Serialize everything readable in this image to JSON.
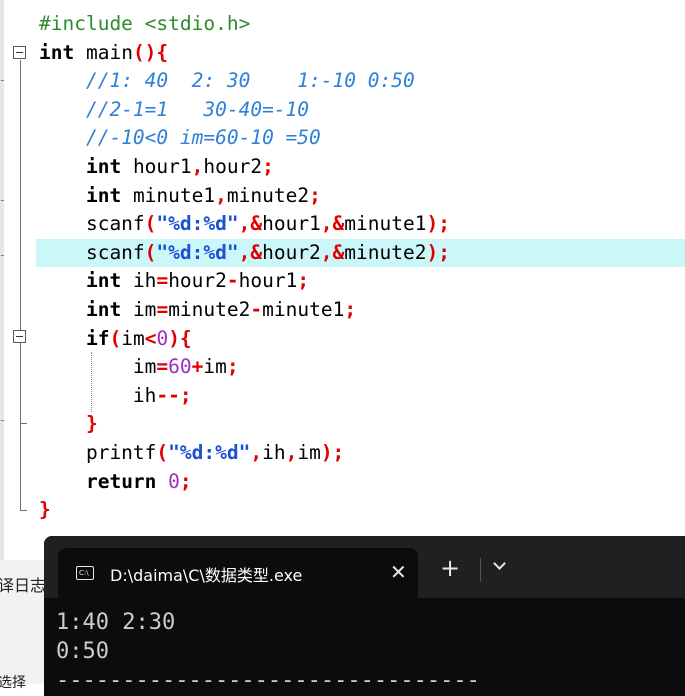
{
  "editor": {
    "lines": [
      [
        {
          "c": "pp",
          "t": "#include <stdio.h>"
        }
      ],
      [
        {
          "c": "k",
          "t": "int"
        },
        {
          "c": "x",
          "t": " main"
        },
        {
          "c": "p",
          "t": "(){"
        }
      ],
      [
        {
          "c": "x",
          "t": "    "
        },
        {
          "c": "cm",
          "t": "//1: 40  2: 30    1:-10 0:50"
        }
      ],
      [
        {
          "c": "x",
          "t": "    "
        },
        {
          "c": "cm",
          "t": "//2-1=1   30-40=-10"
        }
      ],
      [
        {
          "c": "x",
          "t": "    "
        },
        {
          "c": "cm",
          "t": "//-10<0 im=60-10 =50"
        }
      ],
      [
        {
          "c": "x",
          "t": "    "
        },
        {
          "c": "k",
          "t": "int"
        },
        {
          "c": "x",
          "t": " hour1"
        },
        {
          "c": "p",
          "t": ","
        },
        {
          "c": "x",
          "t": "hour2"
        },
        {
          "c": "p",
          "t": ";"
        }
      ],
      [
        {
          "c": "x",
          "t": "    "
        },
        {
          "c": "k",
          "t": "int"
        },
        {
          "c": "x",
          "t": " minute1"
        },
        {
          "c": "p",
          "t": ","
        },
        {
          "c": "x",
          "t": "minute2"
        },
        {
          "c": "p",
          "t": ";"
        }
      ],
      [
        {
          "c": "x",
          "t": "    scanf"
        },
        {
          "c": "p",
          "t": "("
        },
        {
          "c": "s",
          "t": "\"%d:%d\""
        },
        {
          "c": "p",
          "t": ",&"
        },
        {
          "c": "x",
          "t": "hour1"
        },
        {
          "c": "p",
          "t": ",&"
        },
        {
          "c": "x",
          "t": "minute1"
        },
        {
          "c": "p",
          "t": ");"
        }
      ],
      [
        {
          "c": "x",
          "t": "    scanf"
        },
        {
          "c": "p",
          "t": "("
        },
        {
          "c": "s",
          "t": "\"%d:%d\""
        },
        {
          "c": "p",
          "t": ",&"
        },
        {
          "c": "x",
          "t": "hour2"
        },
        {
          "c": "p",
          "t": ",&"
        },
        {
          "c": "x",
          "t": "minute2"
        },
        {
          "c": "p",
          "t": ");"
        }
      ],
      [
        {
          "c": "x",
          "t": "    "
        },
        {
          "c": "k",
          "t": "int"
        },
        {
          "c": "x",
          "t": " ih"
        },
        {
          "c": "p",
          "t": "="
        },
        {
          "c": "x",
          "t": "hour2"
        },
        {
          "c": "p",
          "t": "-"
        },
        {
          "c": "x",
          "t": "hour1"
        },
        {
          "c": "p",
          "t": ";"
        }
      ],
      [
        {
          "c": "x",
          "t": "    "
        },
        {
          "c": "k",
          "t": "int"
        },
        {
          "c": "x",
          "t": " im"
        },
        {
          "c": "p",
          "t": "="
        },
        {
          "c": "x",
          "t": "minute2"
        },
        {
          "c": "p",
          "t": "-"
        },
        {
          "c": "x",
          "t": "minute1"
        },
        {
          "c": "p",
          "t": ";"
        }
      ],
      [
        {
          "c": "x",
          "t": "    "
        },
        {
          "c": "k",
          "t": "if"
        },
        {
          "c": "p",
          "t": "("
        },
        {
          "c": "x",
          "t": "im"
        },
        {
          "c": "p",
          "t": "<"
        },
        {
          "c": "n",
          "t": "0"
        },
        {
          "c": "p",
          "t": "){"
        }
      ],
      [
        {
          "c": "x",
          "t": "        im"
        },
        {
          "c": "p",
          "t": "="
        },
        {
          "c": "n",
          "t": "60"
        },
        {
          "c": "p",
          "t": "+"
        },
        {
          "c": "x",
          "t": "im"
        },
        {
          "c": "p",
          "t": ";"
        }
      ],
      [
        {
          "c": "x",
          "t": "        ih"
        },
        {
          "c": "p",
          "t": "--;"
        }
      ],
      [
        {
          "c": "x",
          "t": "    "
        },
        {
          "c": "p",
          "t": "}"
        }
      ],
      [
        {
          "c": "x",
          "t": "    printf"
        },
        {
          "c": "p",
          "t": "("
        },
        {
          "c": "s",
          "t": "\"%d:%d\""
        },
        {
          "c": "p",
          "t": ","
        },
        {
          "c": "x",
          "t": "ih"
        },
        {
          "c": "p",
          "t": ","
        },
        {
          "c": "x",
          "t": "im"
        },
        {
          "c": "p",
          "t": ");"
        }
      ],
      [
        {
          "c": "x",
          "t": "    "
        },
        {
          "c": "k",
          "t": "return"
        },
        {
          "c": "x",
          "t": " "
        },
        {
          "c": "n",
          "t": "0"
        },
        {
          "c": "p",
          "t": ";"
        }
      ],
      [
        {
          "c": "p",
          "t": "}"
        }
      ]
    ],
    "highlighted_line": 8
  },
  "bottom_panel": {
    "label": "译日志",
    "label2": "选择"
  },
  "terminal": {
    "tab_icon": "C:\\",
    "tab_title": "D:\\daima\\C\\数据类型.exe",
    "close_glyph": "✕",
    "new_tab_glyph": "+",
    "output": "1:40 2:30\n0:50\n--------------------------------"
  },
  "icons": {
    "tab_icon": "console-icon",
    "close": "close-icon",
    "new_tab": "plus-icon",
    "dropdown": "chevron-down-icon"
  },
  "colors": {
    "keyword": "#000000",
    "preprocessor": "#2e8b2e",
    "comment": "#2f80d6",
    "punctuation": "#e00000",
    "string": "#1a4fd6",
    "number": "#9b2fc4",
    "highlight": "#ccf7f8",
    "terminal_bg": "#0c0c0c",
    "terminal_tabbar": "#202020"
  }
}
